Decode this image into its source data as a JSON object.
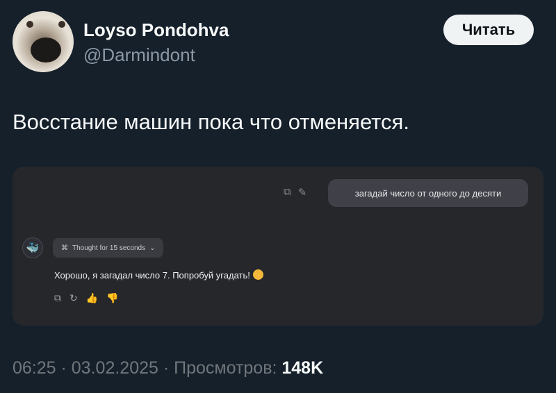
{
  "author": {
    "display_name": "Loyso Pondohva",
    "handle": "@Darmindont"
  },
  "follow_button": {
    "label": "Читать",
    "bg": "#eff3f4"
  },
  "tweet": {
    "text": "Восстание машин пока что отменяется."
  },
  "chat": {
    "user_message": "загадай число от одного до десяти",
    "user_tools": {
      "copy": "⧉",
      "edit": "✎"
    },
    "thought_chip": {
      "icon": "⌘",
      "label": "Thought for 15 seconds",
      "chevron": "⌄"
    },
    "assistant_message": "Хорошо, я загадал число 7. Попробуй угадать!",
    "bot_icon": "🐳",
    "assistant_tools": {
      "copy": "⧉",
      "regenerate": "↻",
      "like": "👍",
      "dislike": "👎"
    }
  },
  "meta": {
    "time": "06:25",
    "separator1": " · ",
    "date": "03.02.2025",
    "separator2": " · ",
    "views_label": "Просмотров: ",
    "views_count": "148K"
  },
  "colors": {
    "background": "#15202b",
    "media_bg": "#26272b",
    "muted_text": "#71767b"
  }
}
